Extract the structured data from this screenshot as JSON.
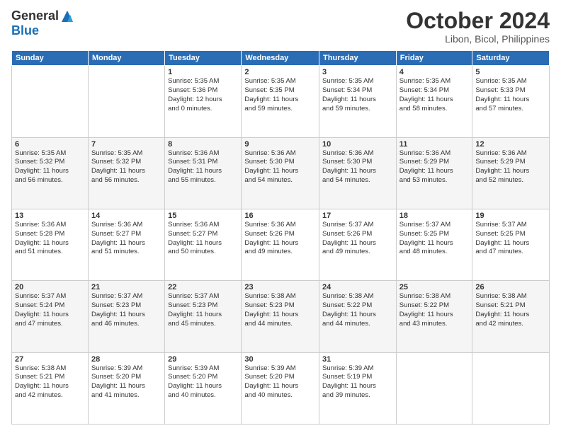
{
  "logo": {
    "general": "General",
    "blue": "Blue"
  },
  "header": {
    "month": "October 2024",
    "location": "Libon, Bicol, Philippines"
  },
  "weekdays": [
    "Sunday",
    "Monday",
    "Tuesday",
    "Wednesday",
    "Thursday",
    "Friday",
    "Saturday"
  ],
  "weeks": [
    [
      {
        "day": "",
        "content": ""
      },
      {
        "day": "",
        "content": ""
      },
      {
        "day": "1",
        "content": "Sunrise: 5:35 AM\nSunset: 5:36 PM\nDaylight: 12 hours\nand 0 minutes."
      },
      {
        "day": "2",
        "content": "Sunrise: 5:35 AM\nSunset: 5:35 PM\nDaylight: 11 hours\nand 59 minutes."
      },
      {
        "day": "3",
        "content": "Sunrise: 5:35 AM\nSunset: 5:34 PM\nDaylight: 11 hours\nand 59 minutes."
      },
      {
        "day": "4",
        "content": "Sunrise: 5:35 AM\nSunset: 5:34 PM\nDaylight: 11 hours\nand 58 minutes."
      },
      {
        "day": "5",
        "content": "Sunrise: 5:35 AM\nSunset: 5:33 PM\nDaylight: 11 hours\nand 57 minutes."
      }
    ],
    [
      {
        "day": "6",
        "content": "Sunrise: 5:35 AM\nSunset: 5:32 PM\nDaylight: 11 hours\nand 56 minutes."
      },
      {
        "day": "7",
        "content": "Sunrise: 5:35 AM\nSunset: 5:32 PM\nDaylight: 11 hours\nand 56 minutes."
      },
      {
        "day": "8",
        "content": "Sunrise: 5:36 AM\nSunset: 5:31 PM\nDaylight: 11 hours\nand 55 minutes."
      },
      {
        "day": "9",
        "content": "Sunrise: 5:36 AM\nSunset: 5:30 PM\nDaylight: 11 hours\nand 54 minutes."
      },
      {
        "day": "10",
        "content": "Sunrise: 5:36 AM\nSunset: 5:30 PM\nDaylight: 11 hours\nand 54 minutes."
      },
      {
        "day": "11",
        "content": "Sunrise: 5:36 AM\nSunset: 5:29 PM\nDaylight: 11 hours\nand 53 minutes."
      },
      {
        "day": "12",
        "content": "Sunrise: 5:36 AM\nSunset: 5:29 PM\nDaylight: 11 hours\nand 52 minutes."
      }
    ],
    [
      {
        "day": "13",
        "content": "Sunrise: 5:36 AM\nSunset: 5:28 PM\nDaylight: 11 hours\nand 51 minutes."
      },
      {
        "day": "14",
        "content": "Sunrise: 5:36 AM\nSunset: 5:27 PM\nDaylight: 11 hours\nand 51 minutes."
      },
      {
        "day": "15",
        "content": "Sunrise: 5:36 AM\nSunset: 5:27 PM\nDaylight: 11 hours\nand 50 minutes."
      },
      {
        "day": "16",
        "content": "Sunrise: 5:36 AM\nSunset: 5:26 PM\nDaylight: 11 hours\nand 49 minutes."
      },
      {
        "day": "17",
        "content": "Sunrise: 5:37 AM\nSunset: 5:26 PM\nDaylight: 11 hours\nand 49 minutes."
      },
      {
        "day": "18",
        "content": "Sunrise: 5:37 AM\nSunset: 5:25 PM\nDaylight: 11 hours\nand 48 minutes."
      },
      {
        "day": "19",
        "content": "Sunrise: 5:37 AM\nSunset: 5:25 PM\nDaylight: 11 hours\nand 47 minutes."
      }
    ],
    [
      {
        "day": "20",
        "content": "Sunrise: 5:37 AM\nSunset: 5:24 PM\nDaylight: 11 hours\nand 47 minutes."
      },
      {
        "day": "21",
        "content": "Sunrise: 5:37 AM\nSunset: 5:23 PM\nDaylight: 11 hours\nand 46 minutes."
      },
      {
        "day": "22",
        "content": "Sunrise: 5:37 AM\nSunset: 5:23 PM\nDaylight: 11 hours\nand 45 minutes."
      },
      {
        "day": "23",
        "content": "Sunrise: 5:38 AM\nSunset: 5:23 PM\nDaylight: 11 hours\nand 44 minutes."
      },
      {
        "day": "24",
        "content": "Sunrise: 5:38 AM\nSunset: 5:22 PM\nDaylight: 11 hours\nand 44 minutes."
      },
      {
        "day": "25",
        "content": "Sunrise: 5:38 AM\nSunset: 5:22 PM\nDaylight: 11 hours\nand 43 minutes."
      },
      {
        "day": "26",
        "content": "Sunrise: 5:38 AM\nSunset: 5:21 PM\nDaylight: 11 hours\nand 42 minutes."
      }
    ],
    [
      {
        "day": "27",
        "content": "Sunrise: 5:38 AM\nSunset: 5:21 PM\nDaylight: 11 hours\nand 42 minutes."
      },
      {
        "day": "28",
        "content": "Sunrise: 5:39 AM\nSunset: 5:20 PM\nDaylight: 11 hours\nand 41 minutes."
      },
      {
        "day": "29",
        "content": "Sunrise: 5:39 AM\nSunset: 5:20 PM\nDaylight: 11 hours\nand 40 minutes."
      },
      {
        "day": "30",
        "content": "Sunrise: 5:39 AM\nSunset: 5:20 PM\nDaylight: 11 hours\nand 40 minutes."
      },
      {
        "day": "31",
        "content": "Sunrise: 5:39 AM\nSunset: 5:19 PM\nDaylight: 11 hours\nand 39 minutes."
      },
      {
        "day": "",
        "content": ""
      },
      {
        "day": "",
        "content": ""
      }
    ]
  ]
}
